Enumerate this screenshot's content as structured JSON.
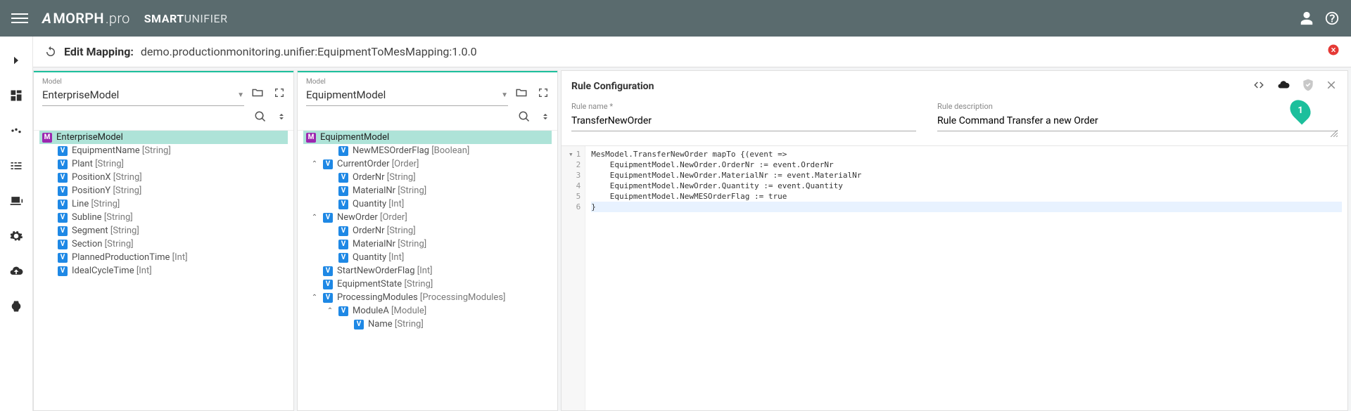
{
  "brand": {
    "prefix": "A",
    "main": "MORPH",
    "suffix": ".pro"
  },
  "product": {
    "strong": "SMART",
    "light": "UNIFIER"
  },
  "breadcrumb": {
    "title": "Edit Mapping:",
    "path": "demo.productionmonitoring.unifier:EquipmentToMesMapping:1.0.0"
  },
  "model1": {
    "label": "Model",
    "name": "EnterpriseModel",
    "root": {
      "label": "EnterpriseModel",
      "badge": "M"
    },
    "items": [
      {
        "label": "EquipmentName",
        "type": "[String]"
      },
      {
        "label": "Plant",
        "type": "[String]"
      },
      {
        "label": "PositionX",
        "type": "[String]"
      },
      {
        "label": "PositionY",
        "type": "[String]"
      },
      {
        "label": "Line",
        "type": "[String]"
      },
      {
        "label": "Subline",
        "type": "[String]"
      },
      {
        "label": "Segment",
        "type": "[String]"
      },
      {
        "label": "Section",
        "type": "[String]"
      },
      {
        "label": "PlannedProductionTime",
        "type": "[Int]"
      },
      {
        "label": "IdealCycleTime",
        "type": "[Int]"
      }
    ]
  },
  "model2": {
    "label": "Model",
    "name": "EquipmentModel",
    "root": {
      "label": "EquipmentModel",
      "badge": "M"
    },
    "nodes": [
      {
        "indent": 1,
        "toggle": "",
        "label": "NewMESOrderFlag",
        "type": "[Boolean]"
      },
      {
        "indent": 0,
        "toggle": "open",
        "label": "CurrentOrder",
        "type": "[Order]"
      },
      {
        "indent": 1,
        "toggle": "",
        "label": "OrderNr",
        "type": "[String]"
      },
      {
        "indent": 1,
        "toggle": "",
        "label": "MaterialNr",
        "type": "[String]"
      },
      {
        "indent": 1,
        "toggle": "",
        "label": "Quantity",
        "type": "[Int]"
      },
      {
        "indent": 0,
        "toggle": "open",
        "label": "NewOrder",
        "type": "[Order]"
      },
      {
        "indent": 1,
        "toggle": "",
        "label": "OrderNr",
        "type": "[String]"
      },
      {
        "indent": 1,
        "toggle": "",
        "label": "MaterialNr",
        "type": "[String]"
      },
      {
        "indent": 1,
        "toggle": "",
        "label": "Quantity",
        "type": "[Int]"
      },
      {
        "indent": 0,
        "toggle": "",
        "label": "StartNewOrderFlag",
        "type": "[Int]"
      },
      {
        "indent": 0,
        "toggle": "",
        "label": "EquipmentState",
        "type": "[String]"
      },
      {
        "indent": 0,
        "toggle": "open",
        "label": "ProcessingModules",
        "type": "[ProcessingModules]"
      },
      {
        "indent": 1,
        "toggle": "open",
        "label": "ModuleA",
        "type": "[Module]"
      },
      {
        "indent": 2,
        "toggle": "",
        "label": "Name",
        "type": "[String]"
      }
    ]
  },
  "rule": {
    "title": "Rule Configuration",
    "name_label": "Rule name *",
    "name_value": "TransferNewOrder",
    "desc_label": "Rule description",
    "desc_value": "Rule Command Transfer a new Order",
    "code": [
      "MesModel.TransferNewOrder mapTo {(event =>",
      "    EquipmentModel.NewOrder.OrderNr := event.OrderNr",
      "    EquipmentModel.NewOrder.MaterialNr := event.MaterialNr",
      "    EquipmentModel.NewOrder.Quantity := event.Quantity",
      "    EquipmentModel.NewMESOrderFlag := true",
      "}"
    ]
  },
  "marker": "1"
}
